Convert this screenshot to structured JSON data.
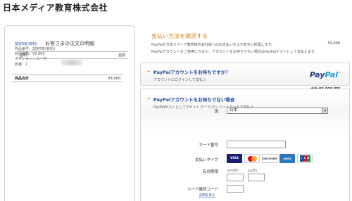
{
  "merchant": {
    "name": "日本メディア教育株式会社"
  },
  "order": {
    "title": "お客さまの注文の明細",
    "col_description": "説明",
    "col_amount": "金額",
    "item_name": "認定6年(有料)",
    "item_price": "¥3,000",
    "item_number": "商品番号：認定6年(有料)",
    "item_unit_price": "商品価格：¥3,000",
    "item_option": "オプション：ユーザ",
    "item_quantity": "数量：1",
    "subtotal_label": "商品合計",
    "subtotal_value": "¥3,000",
    "total": "合計 ¥3,000 JPY"
  },
  "payment": {
    "heading": "支払い方法を選択する",
    "desc1": "PayPalが日本メディア教育株式会社様へのお支払いをより安全に処理します。",
    "desc2": "PayPalアカウントをご使用になるか、アカウントをお持ちでない場合はPayPalゲストとして支払えます。"
  },
  "login_panel": {
    "title": "PayPalアカウントをお持ちですか？",
    "sub": "アカウントにログインして支払う",
    "logo_pay": "Pay",
    "logo_pal": "Pal",
    "logo_tm": "™"
  },
  "guest_panel": {
    "title": "PayPalアカウントをお持ちでない場合",
    "sub": "PayPalゲストとしてデビットカード/クレジットカードで支払う",
    "country_label": "国",
    "country_value": "日本",
    "card_number_label": "カード番号",
    "card_type_label": "支払いタイプ",
    "expiry_label": "有効期限",
    "month_label": "mm(月)",
    "year_label": "yy(年)",
    "csc_label": "カード確認コード",
    "csc_link": "説明を見る"
  },
  "cards": [
    "VISA",
    "MasterCard",
    "DISCOVER",
    "AMEX",
    "JCB"
  ]
}
